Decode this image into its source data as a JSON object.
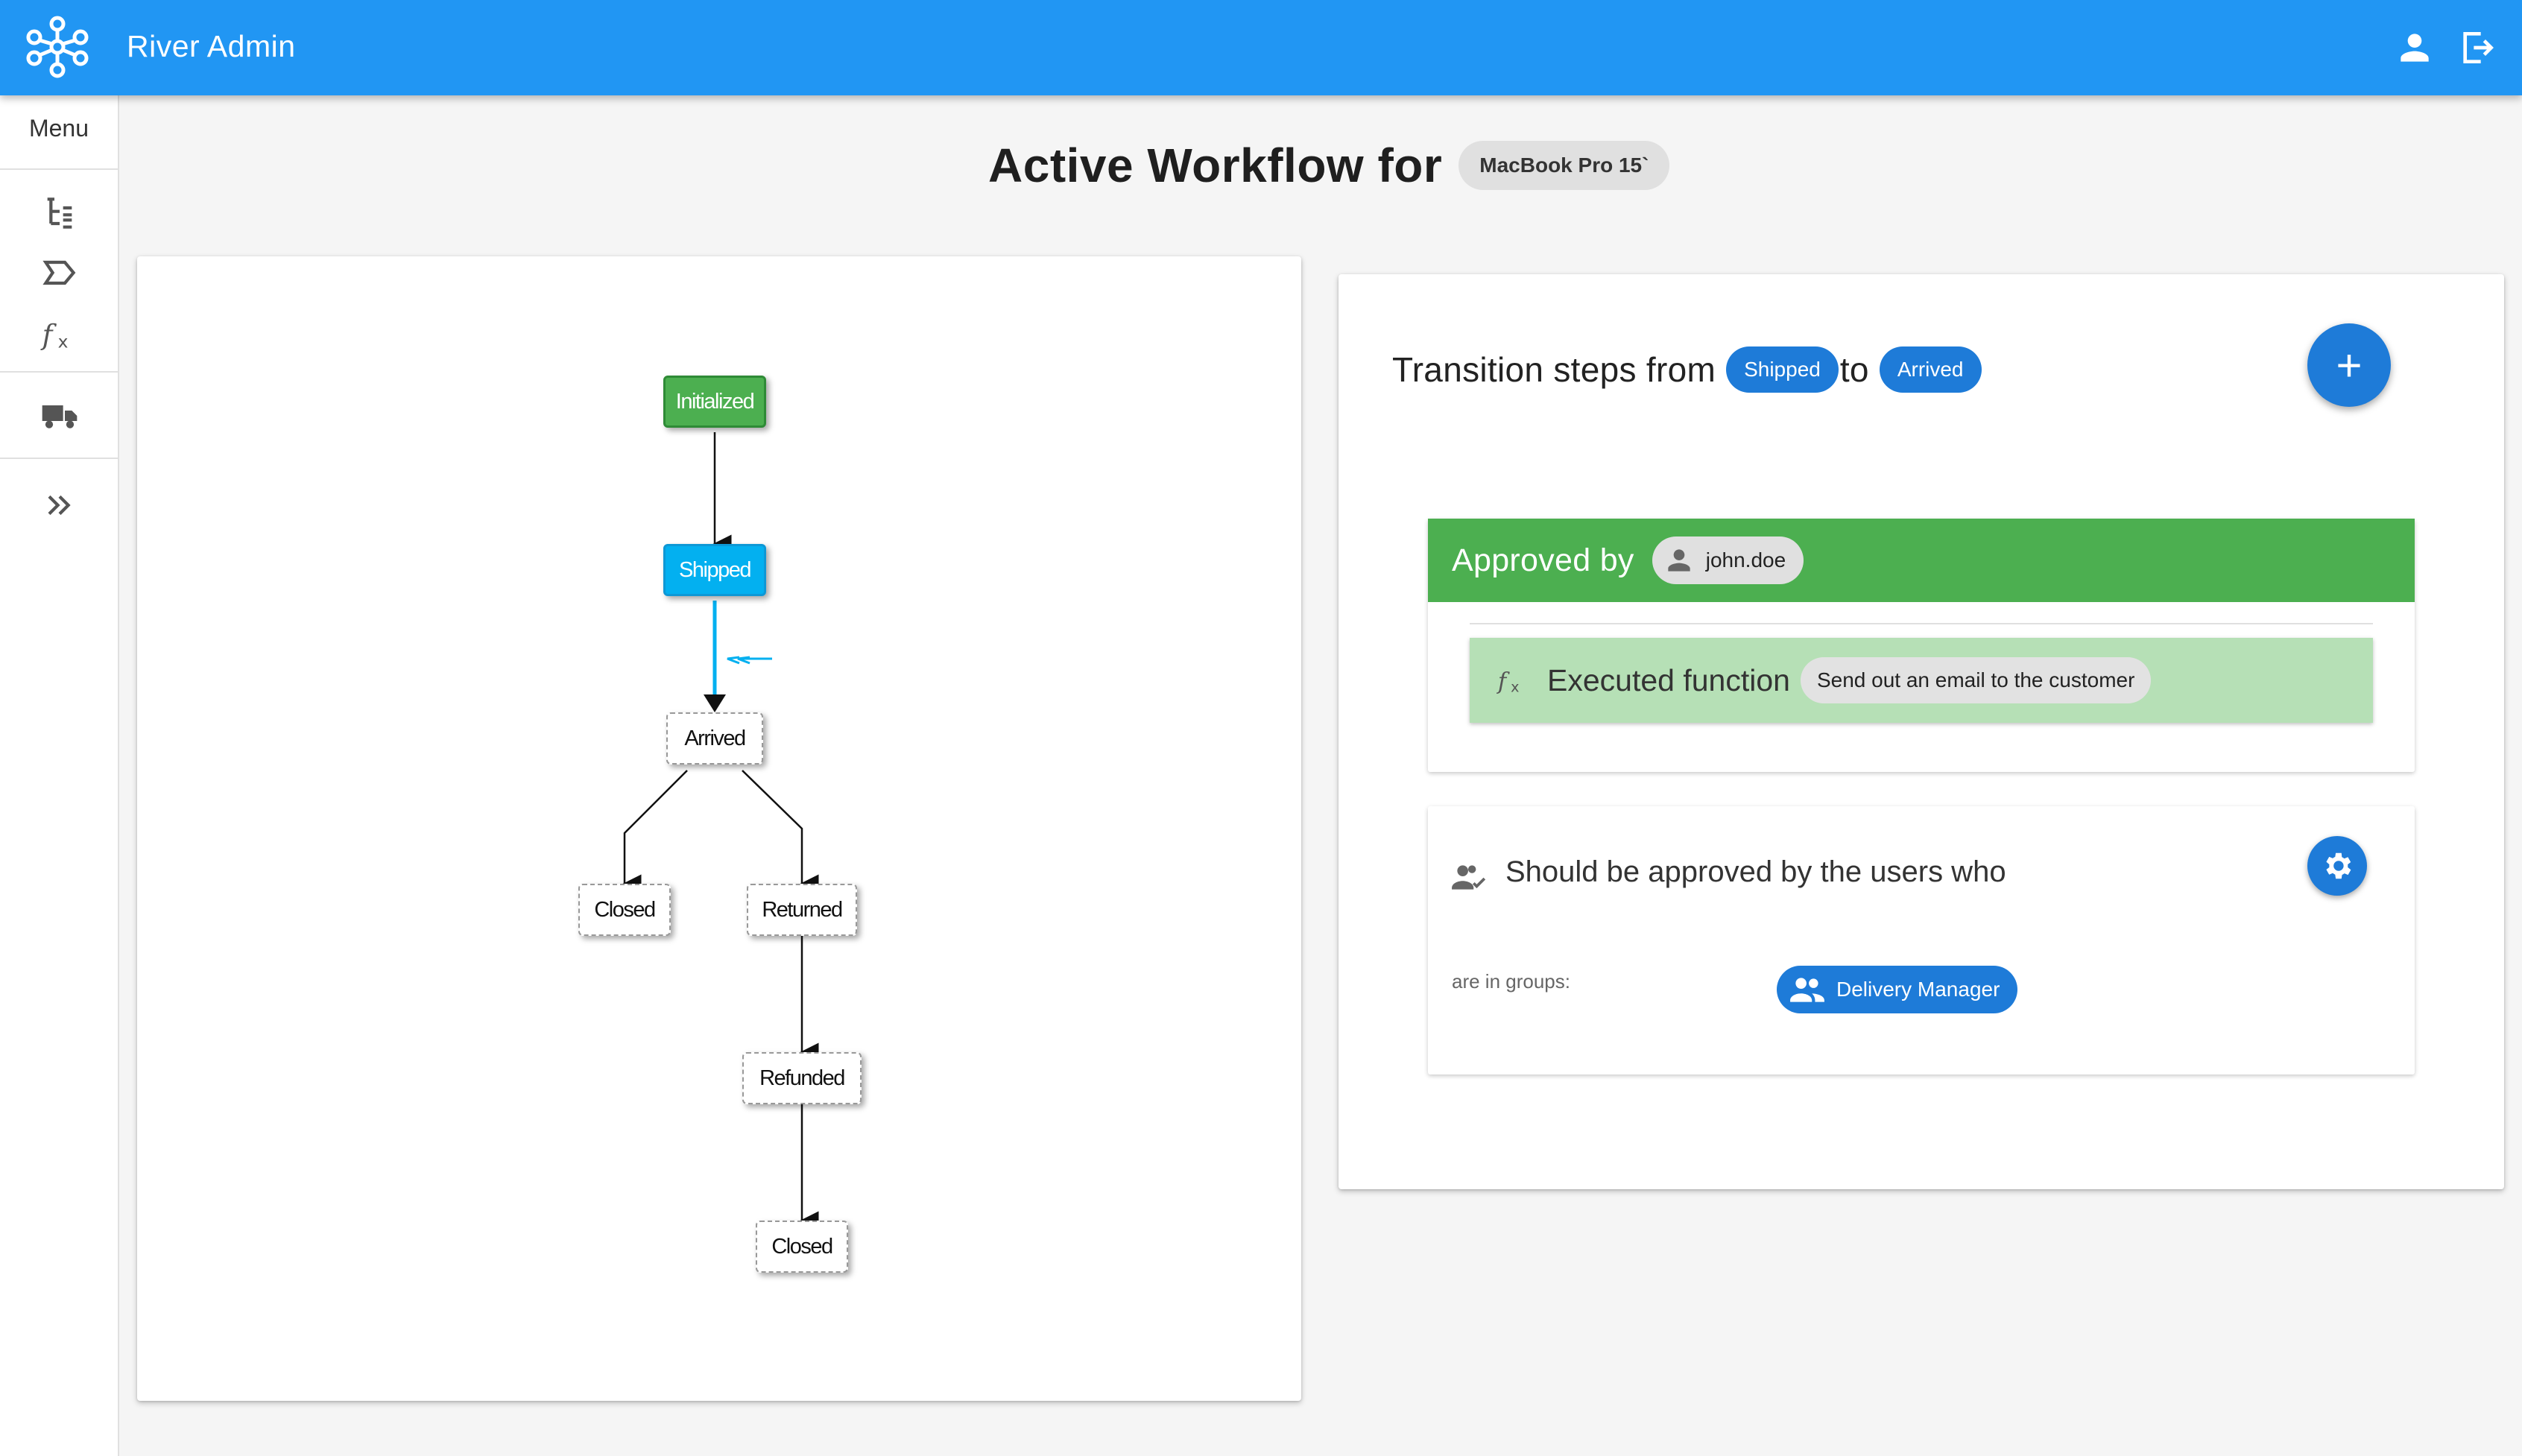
{
  "app": {
    "title": "River Admin",
    "logo_icon": "network-logo-icon",
    "account_icon": "account-icon",
    "logout_icon": "logout-icon",
    "brand_color": "#2196f3"
  },
  "sidebar": {
    "menu_label": "Menu",
    "items": [
      {
        "icon": "workflow-tree-icon"
      },
      {
        "icon": "state-tag-icon"
      },
      {
        "icon": "function-fx-icon"
      },
      {
        "icon": "truck-icon"
      },
      {
        "icon": "expand-chevrons-icon"
      }
    ]
  },
  "header": {
    "title": "Active Workflow for",
    "object_chip": "MacBook Pro 15`"
  },
  "workflow_graph": {
    "nodes": [
      {
        "id": "initialized",
        "label": "Initialized",
        "kind": "initial"
      },
      {
        "id": "shipped",
        "label": "Shipped",
        "kind": "current"
      },
      {
        "id": "arrived",
        "label": "Arrived",
        "kind": "plain"
      },
      {
        "id": "closed1",
        "label": "Closed",
        "kind": "plain"
      },
      {
        "id": "returned",
        "label": "Returned",
        "kind": "plain"
      },
      {
        "id": "refunded",
        "label": "Refunded",
        "kind": "plain"
      },
      {
        "id": "closed2",
        "label": "Closed",
        "kind": "plain"
      }
    ],
    "edges": [
      {
        "from": "initialized",
        "to": "shipped"
      },
      {
        "from": "shipped",
        "to": "arrived",
        "highlighted": true
      },
      {
        "from": "arrived",
        "to": "closed1"
      },
      {
        "from": "arrived",
        "to": "returned"
      },
      {
        "from": "returned",
        "to": "refunded"
      },
      {
        "from": "refunded",
        "to": "closed2"
      }
    ],
    "colors": {
      "initial": "#4caf50",
      "current": "#03b0f0",
      "highlight_edge": "#03b0f0"
    }
  },
  "transition": {
    "prefix": "Transition steps from",
    "source_state": "Shipped",
    "joiner": "to",
    "destination_state": "Arrived",
    "add_button": "+"
  },
  "approval": {
    "label": "Approved by",
    "user": "john.doe",
    "hook_label": "Executed function",
    "hook_function": "Send out an email to the customer"
  },
  "approval_rule": {
    "text": "Should be approved by the users who",
    "groups_label": "are in groups:",
    "group": "Delivery Manager"
  }
}
